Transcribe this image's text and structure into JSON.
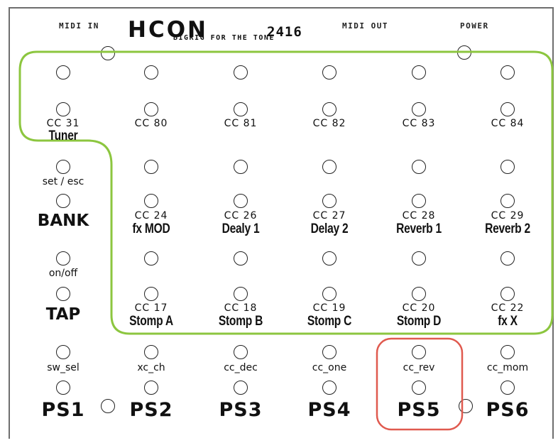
{
  "device": {
    "brand": "HCON",
    "model": "2416",
    "tagline": "BIGRIG FOR THE TONE",
    "ports": {
      "midi_in": "MIDI IN",
      "midi_out": "MIDI OUT",
      "power": "POWER"
    }
  },
  "left_column": {
    "cc_label": "CC 31",
    "name": "Tuner",
    "bank_small": "set / esc",
    "bank_big": "BANK",
    "tap_small": "on/off",
    "tap_big": "TAP",
    "ps_small": "sw_sel",
    "ps_big": "PS1"
  },
  "columns": [
    {
      "cc_top": "CC 80",
      "cc_mid": "CC 24",
      "mid_name": "fx MOD",
      "cc_low": "CC 17",
      "low_name": "Stomp A",
      "ps_small": "xc_ch",
      "ps_big": "PS2"
    },
    {
      "cc_top": "CC 81",
      "cc_mid": "CC 26",
      "mid_name": "Dealy 1",
      "cc_low": "CC 18",
      "low_name": "Stomp B",
      "ps_small": "cc_dec",
      "ps_big": "PS3"
    },
    {
      "cc_top": "CC 82",
      "cc_mid": "CC 27",
      "mid_name": "Delay 2",
      "cc_low": "CC 19",
      "low_name": "Stomp C",
      "ps_small": "cc_one",
      "ps_big": "PS4"
    },
    {
      "cc_top": "CC 83",
      "cc_mid": "CC 28",
      "mid_name": "Reverb 1",
      "cc_low": "CC 20",
      "low_name": "Stomp D",
      "ps_small": "cc_rev",
      "ps_big": "PS5"
    },
    {
      "cc_top": "CC 84",
      "cc_mid": "CC 29",
      "mid_name": "Reverb 2",
      "cc_low": "CC 22",
      "low_name": "fx X",
      "ps_small": "cc_mom",
      "ps_big": "PS6"
    }
  ],
  "colors": {
    "outline_green": "#8cc63f",
    "highlight_red": "#e05a4f"
  },
  "highlighted_column": "PS5"
}
